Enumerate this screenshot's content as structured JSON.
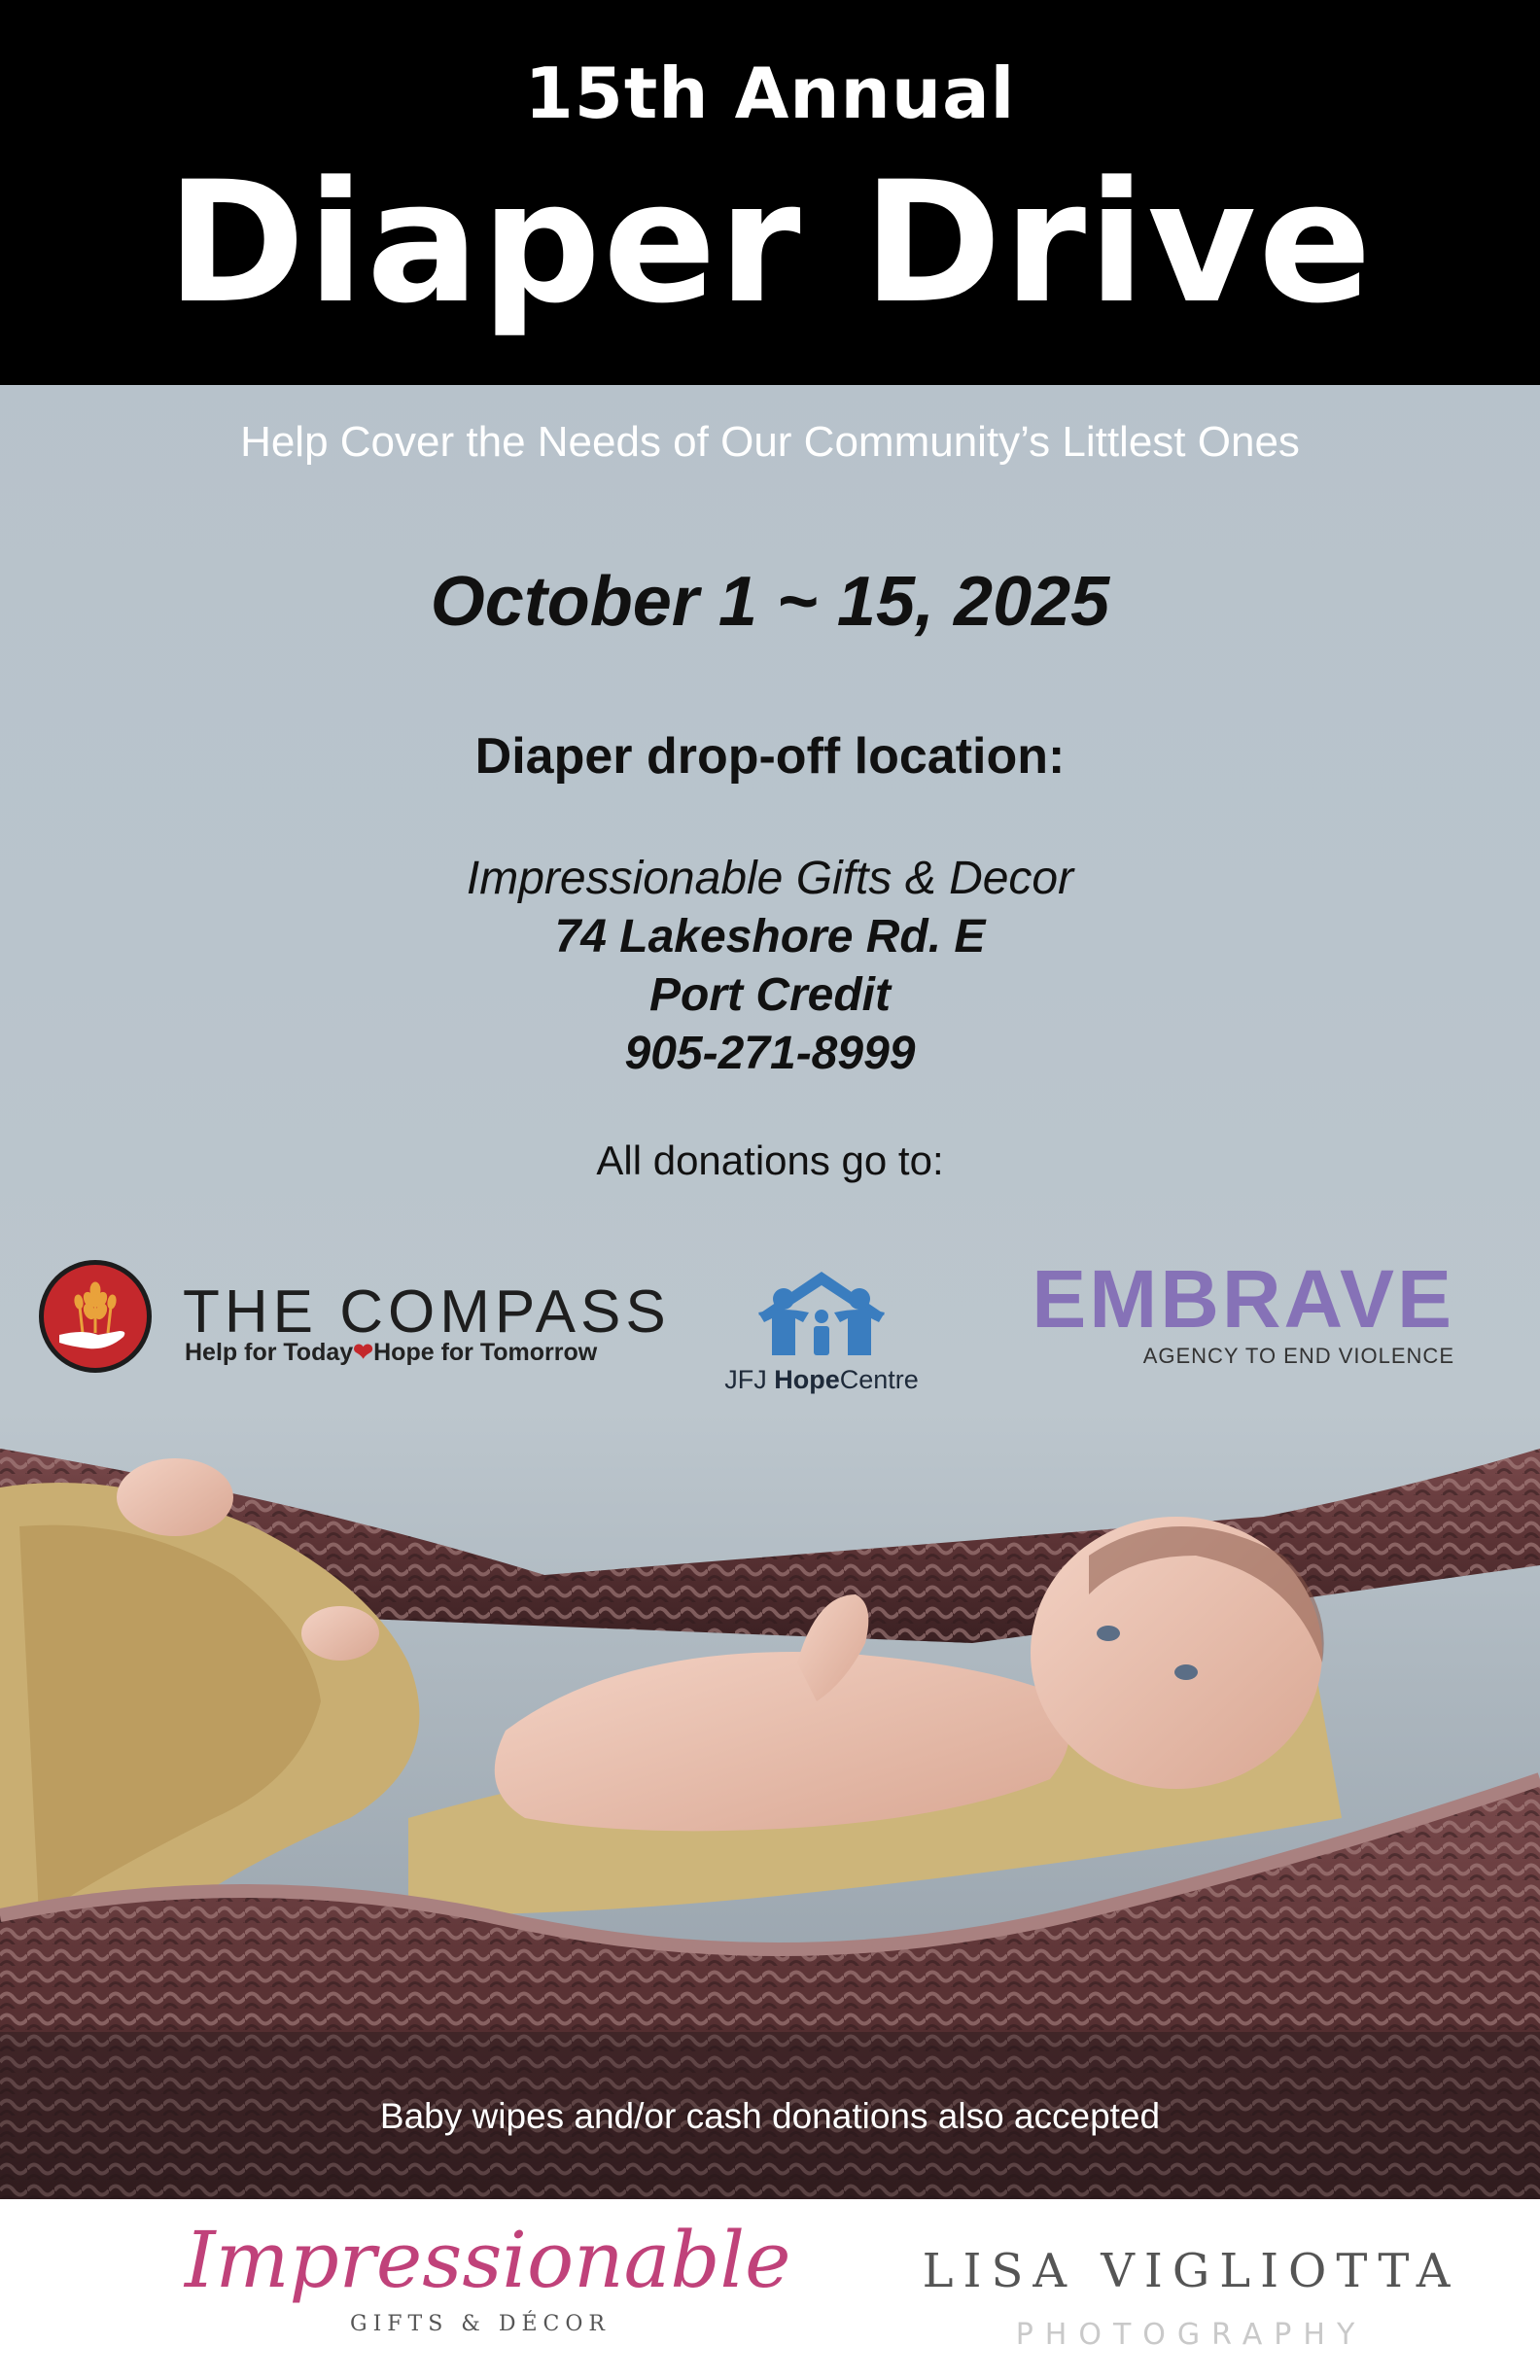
{
  "header": {
    "annual": "15th Annual",
    "title": "Diaper Drive"
  },
  "tagline": "Help Cover the Needs of Our Community’s Littlest Ones",
  "dates": "October 1 ~ 15, 2025",
  "dropoff": {
    "heading": "Diaper drop-off location:",
    "store": "Impressionable Gifts & Decor",
    "address": "74 Lakeshore Rd. E",
    "city": "Port Credit",
    "phone": "905-271-8999"
  },
  "donations_heading": "All donations go to:",
  "partners": {
    "compass": {
      "name": "THE COMPASS",
      "tag_left": "Help for Today",
      "tag_right": "Hope for Tomorrow",
      "icon": "wheat-hand-icon",
      "color": "#c4282c"
    },
    "jfj": {
      "name_prefix": "JFJ ",
      "name_bold": "Hope",
      "name_suffix": "Centre",
      "icon": "family-house-icon",
      "color": "#3a7dbf"
    },
    "embrave": {
      "name": "EMBRAVE",
      "tag": "AGENCY TO END VIOLENCE",
      "color": "#8672b7"
    }
  },
  "photo": {
    "subject": "baby-in-basket-photo"
  },
  "note": "Baby wipes and/or cash donations also accepted",
  "sponsors": {
    "impressionable": {
      "name": "Impressionable",
      "sub": "GIFTS & DÉCOR",
      "color": "#c0427a"
    },
    "lisa": {
      "name": "LISA VIGLIOTTA",
      "sub": "PHOTOGRAPHY"
    }
  }
}
